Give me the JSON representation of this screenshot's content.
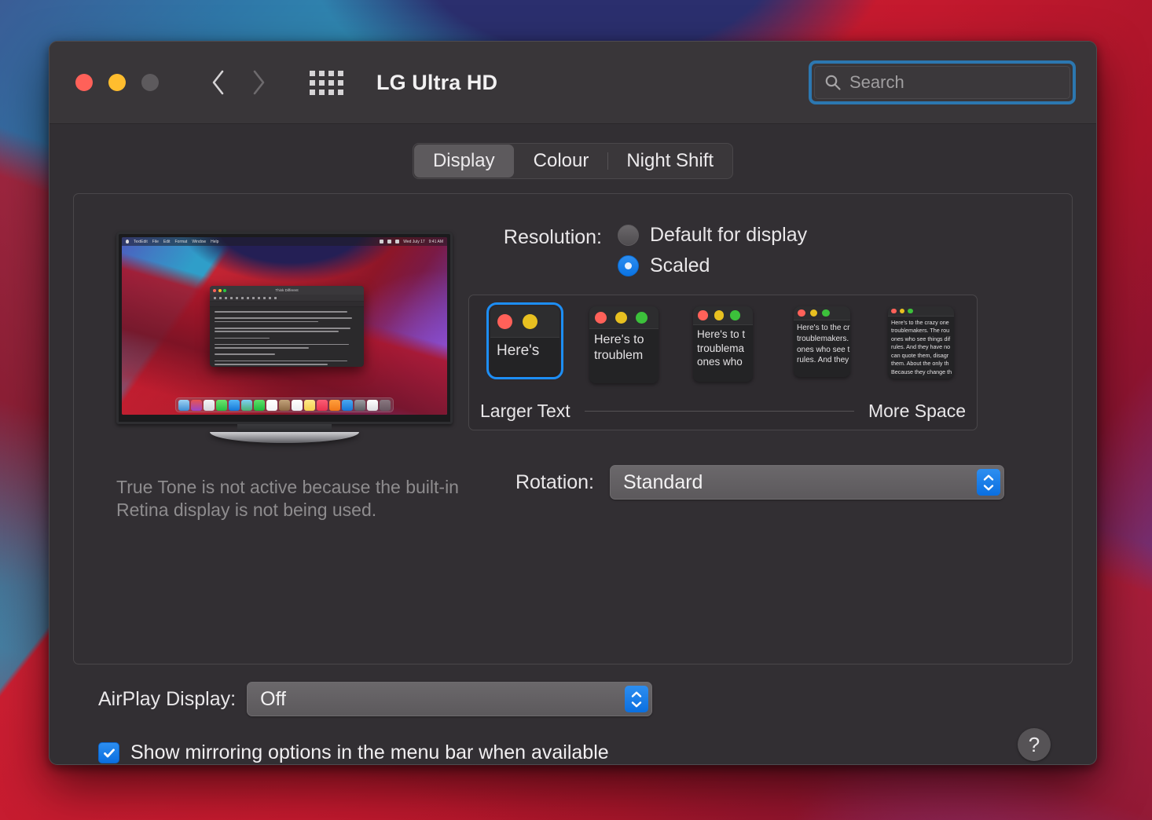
{
  "window": {
    "title": "LG Ultra HD",
    "traffic_lights": [
      "close",
      "minimize",
      "zoom"
    ],
    "nav": {
      "back": "back-chevron",
      "forward": "forward-chevron",
      "grid": "show-all-grid"
    }
  },
  "search": {
    "placeholder": "Search",
    "value": "",
    "icon": "search-icon",
    "focused": true
  },
  "tabs": [
    {
      "label": "Display",
      "selected": true
    },
    {
      "label": "Colour",
      "selected": false
    },
    {
      "label": "Night Shift",
      "selected": false
    }
  ],
  "preview": {
    "menubar": {
      "apple": "",
      "items": [
        "TextEdit",
        "File",
        "Edit",
        "Format",
        "Window",
        "Help"
      ],
      "clock": "Wed July 17",
      "time": "9:41 AM"
    },
    "document_title": "Think Different",
    "dock_icons": [
      "Finder",
      "Launchpad",
      "Safari",
      "Messages",
      "Mail",
      "Maps",
      "FaceTime",
      "Calendar",
      "Contacts",
      "Reminders",
      "Notes",
      "Music",
      "Books",
      "App Store",
      "System Preferences",
      "TextEdit",
      "Trash"
    ]
  },
  "true_tone_note": "True Tone is not active because the built-in Retina display is not being used.",
  "resolution": {
    "label": "Resolution:",
    "options": [
      {
        "label": "Default for display",
        "selected": false
      },
      {
        "label": "Scaled",
        "selected": true
      }
    ]
  },
  "scale_picker": {
    "left_label": "Larger Text",
    "right_label": "More Space",
    "selected_index": 0,
    "thumbnails": [
      {
        "text": "Here's",
        "selected": true,
        "dots": 2
      },
      {
        "text": "Here's to\ntroublem",
        "selected": false,
        "dots": 3
      },
      {
        "text": "Here's to t\ntroublema\nones who",
        "selected": false,
        "dots": 3
      },
      {
        "text": "Here's to the cr\ntroublemakers.\nones who see t\nrules. And they",
        "selected": false,
        "dots": 3
      },
      {
        "text": "Here's to the crazy one\ntroublemakers. The rou\nones who see things dif\nrules. And they have no\ncan quote them, disagr\nthem. About the only th\nBecause they change th",
        "selected": false,
        "dots": 3
      }
    ]
  },
  "rotation": {
    "label": "Rotation:",
    "value": "Standard"
  },
  "airplay": {
    "label": "AirPlay Display:",
    "value": "Off"
  },
  "mirroring": {
    "label": "Show mirroring options in the menu bar when available",
    "checked": true
  },
  "help": {
    "label": "?"
  },
  "colors": {
    "accent_blue": "#0a6fe0",
    "focus_ring": "#2c77b0",
    "selection_blue": "#1d8ef5",
    "window_bg": "#322f33",
    "titlebar_bg": "#393639",
    "text_primary": "#e9e7e9",
    "text_secondary": "#8e8c8e",
    "traffic_red": "#ff6159",
    "traffic_yellow": "#ffbd2e",
    "traffic_gray": "#5d5a5d"
  }
}
